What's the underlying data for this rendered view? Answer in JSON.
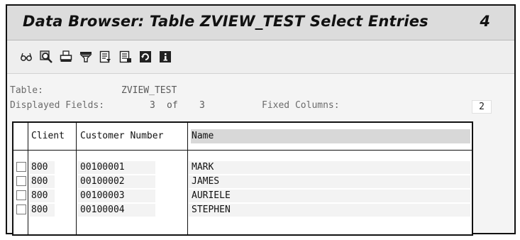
{
  "window": {
    "title": "Data Browser: Table ZVIEW_TEST Select Entries",
    "session_number": "4"
  },
  "toolbar": {
    "icons": [
      "glasses-icon",
      "magnifier-icon",
      "printer-icon",
      "filter-icon",
      "export-icon",
      "list-icon",
      "refresh-icon",
      "info-icon"
    ]
  },
  "info": {
    "table_label": "Table:",
    "table_value": "ZVIEW_TEST",
    "fields_label": "Displayed Fields:",
    "fields_shown": "3",
    "fields_of": "of",
    "fields_total": "3",
    "fixed_columns_label": "Fixed Columns:",
    "fixed_columns_value": "2"
  },
  "table": {
    "columns": [
      "Client",
      "Customer Number",
      "Name"
    ],
    "rows": [
      {
        "client": "800",
        "customer_number": "00100001",
        "name": "MARK"
      },
      {
        "client": "800",
        "customer_number": "00100002",
        "name": "JAMES"
      },
      {
        "client": "800",
        "customer_number": "00100003",
        "name": "AURIELE"
      },
      {
        "client": "800",
        "customer_number": "00100004",
        "name": "STEPHEN"
      }
    ]
  }
}
